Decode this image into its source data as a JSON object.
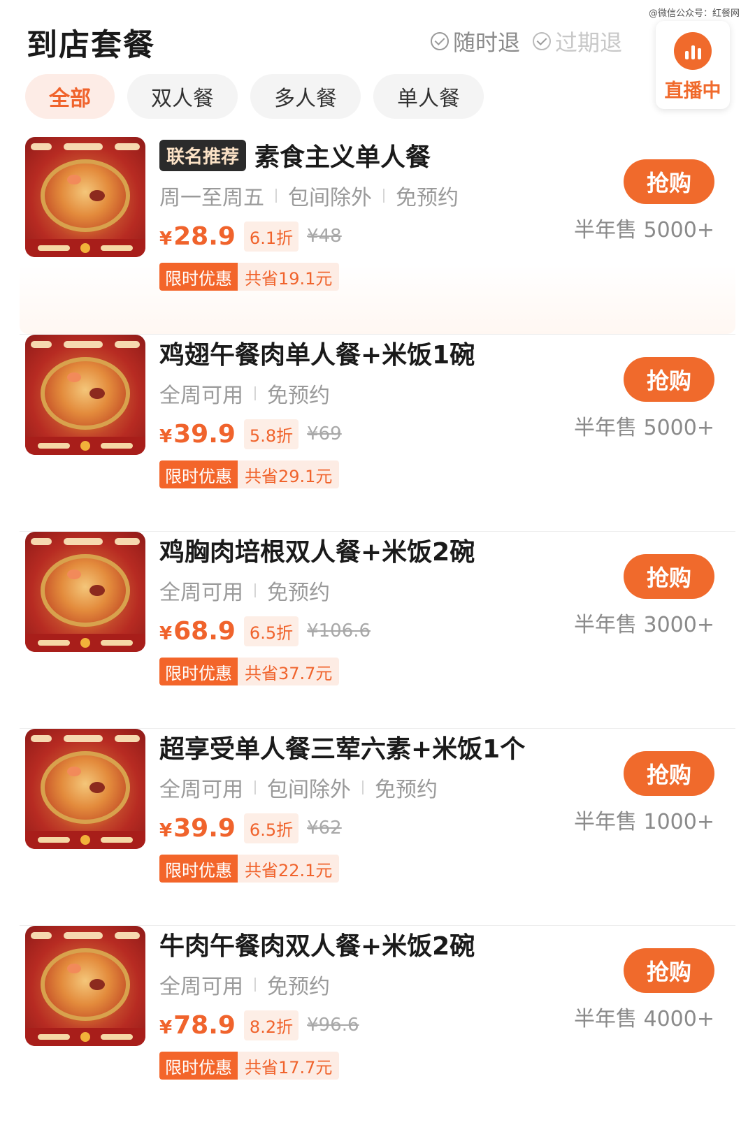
{
  "watermark": "@微信公众号：红餐网",
  "header": {
    "title": "到店套餐",
    "guarantees": [
      "随时退",
      "过期退"
    ],
    "live_label": "直播中"
  },
  "filters": [
    "全部",
    "双人餐",
    "多人餐",
    "单人餐"
  ],
  "accent_color": "#f06a2c",
  "deals": [
    {
      "badge": "联名推荐",
      "title": "素食主义单人餐",
      "tags": [
        "周一至周五",
        "包间除外",
        "免预约"
      ],
      "currency": "¥",
      "price": "28.9",
      "discount": "6.1折",
      "original_price": "¥48",
      "promo_label": "限时优惠",
      "promo_save": "共省19.1元",
      "buy_label": "抢购",
      "sales": "半年售 5000+"
    },
    {
      "badge": "",
      "title": "鸡翅午餐肉单人餐+米饭1碗",
      "tags": [
        "全周可用",
        "免预约"
      ],
      "currency": "¥",
      "price": "39.9",
      "discount": "5.8折",
      "original_price": "¥69",
      "promo_label": "限时优惠",
      "promo_save": "共省29.1元",
      "buy_label": "抢购",
      "sales": "半年售 5000+"
    },
    {
      "badge": "",
      "title": "鸡胸肉培根双人餐+米饭2碗",
      "tags": [
        "全周可用",
        "免预约"
      ],
      "currency": "¥",
      "price": "68.9",
      "discount": "6.5折",
      "original_price": "¥106.6",
      "promo_label": "限时优惠",
      "promo_save": "共省37.7元",
      "buy_label": "抢购",
      "sales": "半年售 3000+"
    },
    {
      "badge": "",
      "title": "超享受单人餐三荤六素+米饭1个",
      "tags": [
        "全周可用",
        "包间除外",
        "免预约"
      ],
      "currency": "¥",
      "price": "39.9",
      "discount": "6.5折",
      "original_price": "¥62",
      "promo_label": "限时优惠",
      "promo_save": "共省22.1元",
      "buy_label": "抢购",
      "sales": "半年售 1000+"
    },
    {
      "badge": "",
      "title": "牛肉午餐肉双人餐+米饭2碗",
      "tags": [
        "全周可用",
        "免预约"
      ],
      "currency": "¥",
      "price": "78.9",
      "discount": "8.2折",
      "original_price": "¥96.6",
      "promo_label": "限时优惠",
      "promo_save": "共省17.7元",
      "buy_label": "抢购",
      "sales": "半年售 4000+"
    }
  ]
}
